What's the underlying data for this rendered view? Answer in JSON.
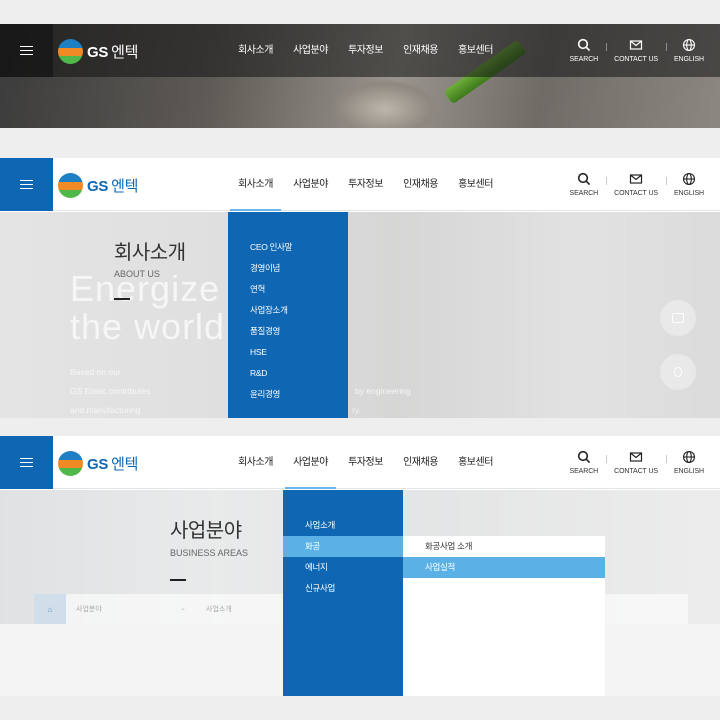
{
  "header": {
    "logo_gs": "GS",
    "logo_kr": "엔텍",
    "nav": [
      "회사소개",
      "사업분야",
      "투자정보",
      "인재채용",
      "홍보센터"
    ],
    "util": [
      {
        "icon": "search-icon",
        "label": "SEARCH"
      },
      {
        "icon": "mail-icon",
        "label": "CONTACT US"
      },
      {
        "icon": "globe-icon",
        "label": "ENGLISH"
      }
    ]
  },
  "about": {
    "title": "회사소개",
    "subtitle": "ABOUT US",
    "dropdown": [
      "CEO 인사말",
      "경영이념",
      "연혁",
      "사업장소개",
      "품질경영",
      "HSE",
      "R&D",
      "윤리경영"
    ],
    "hero_big_1": "Energize",
    "hero_big_2": "the world",
    "hero_line_1": "Based on our",
    "hero_line_2": "GS Entec contributes",
    "hero_line_2b": "by engineering",
    "hero_line_3": "and manufacturing",
    "hero_line_3b": "ry."
  },
  "business": {
    "title": "사업분야",
    "subtitle": "BUSINESS AREAS",
    "dropdown": [
      "사업소개",
      "화공",
      "에너지",
      "신규사업"
    ],
    "active_index": 1,
    "submenu": [
      "화공사업 소개",
      "사업실적"
    ],
    "submenu_active_index": 1,
    "crumb_1": "사업분야",
    "crumb_2": "사업소개"
  },
  "colors": {
    "brand_blue": "#0f66b2",
    "highlight": "#5bb1e5"
  }
}
